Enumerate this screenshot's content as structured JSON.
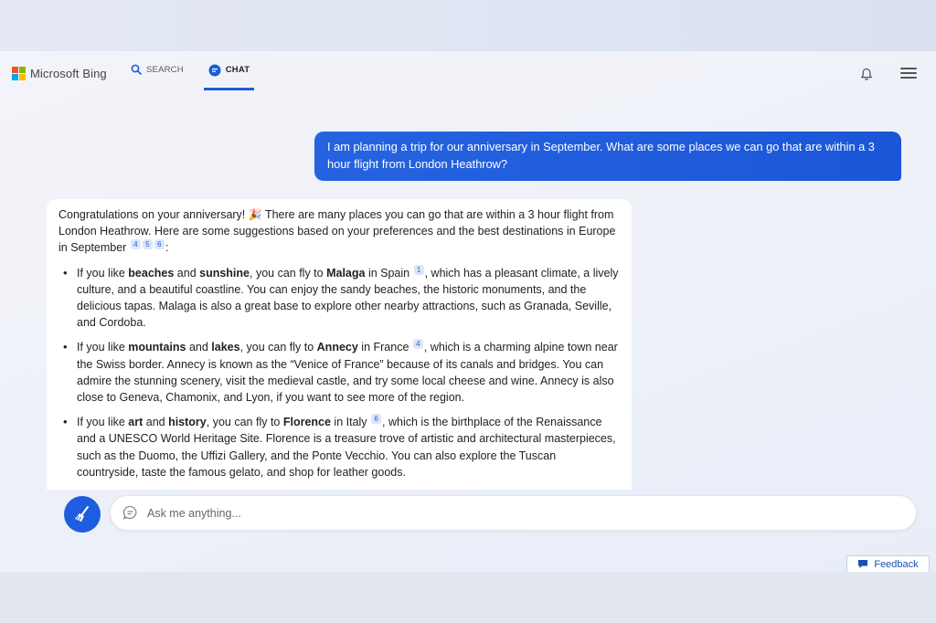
{
  "header": {
    "logo_text": "Microsoft Bing",
    "tabs": [
      {
        "label": "SEARCH",
        "active": false
      },
      {
        "label": "CHAT",
        "active": true
      }
    ]
  },
  "colors": {
    "accent": "#1b5ed8",
    "user_bubble": "#2563e0",
    "citation_bg": "#dce6fb"
  },
  "conversation": {
    "user_message": "I am planning a trip for our anniversary in September. What are some places we can go that are within a 3 hour flight from London Heathrow?",
    "bot": {
      "intro": "Congratulations on your anniversary! ",
      "intro_emoji": "🎉",
      "intro_rest": " There are many places you can go that are within a 3 hour flight from London Heathrow. Here are some suggestions based on your preferences and the best destinations in Europe in September",
      "intro_citations": [
        "4",
        "5",
        "6"
      ],
      "intro_end": ":",
      "items": [
        {
          "t1": "If you like ",
          "b1": "beaches",
          "t2": " and ",
          "b2": "sunshine",
          "t3": ", you can fly to ",
          "b3": "Malaga",
          "t4": " in Spain",
          "cite": "1",
          "t5": ", which has a pleasant climate, a lively culture, and a beautiful coastline. You can enjoy the sandy beaches, the historic monuments, and the delicious tapas. Malaga is also a great base to explore other nearby attractions, such as Granada, Seville, and Cordoba."
        },
        {
          "t1": "If you like ",
          "b1": "mountains",
          "t2": " and ",
          "b2": "lakes",
          "t3": ", you can fly to ",
          "b3": "Annecy",
          "t4": " in France",
          "cite": "4",
          "t5": ", which is a charming alpine town near the Swiss border. Annecy is known as the “Venice of France” because of its canals and bridges. You can admire the stunning scenery, visit the medieval castle, and try some local cheese and wine. Annecy is also close to Geneva, Chamonix, and Lyon, if you want to see more of the region."
        },
        {
          "t1": "If you like ",
          "b1": "art",
          "t2": " and ",
          "b2": "history",
          "t3": ", you can fly to ",
          "b3": "Florence",
          "t4": " in Italy",
          "cite": "6",
          "t5": ", which is the birthplace of the Renaissance and a UNESCO World Heritage Site. Florence is a treasure trove of artistic and architectural masterpieces, such as the Duomo, the Uffizi Gallery, and the Ponte Vecchio. You can also explore the Tuscan countryside, taste the famous gelato, and shop for leather goods."
        }
      ]
    }
  },
  "composer": {
    "placeholder": "Ask me anything..."
  },
  "feedback_label": "Feedback"
}
